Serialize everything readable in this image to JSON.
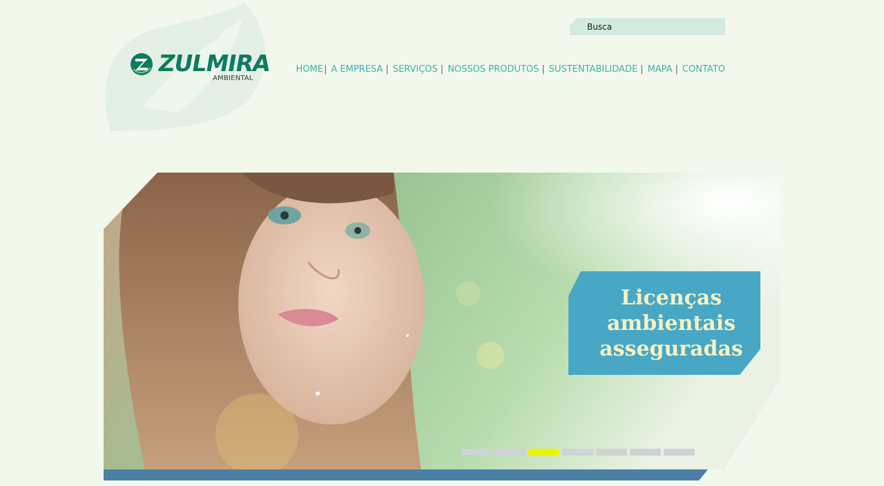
{
  "brand": {
    "name": "ZULMIRA",
    "subtitle": "AMBIENTAL",
    "colors": {
      "primary": "#0f7a5e",
      "nav": "#3ab1aa",
      "accent_bar": "#4a7fa6",
      "caption_bg": "#48a7c4",
      "caption_text": "#f4f2c4",
      "active_dot": "#ecf500"
    }
  },
  "search": {
    "placeholder": "Busca"
  },
  "nav": {
    "items": [
      {
        "label": "HOME"
      },
      {
        "label": "A EMPRESA"
      },
      {
        "label": "SERVIÇOS"
      },
      {
        "label": "NOSSOS PRODUTOS"
      },
      {
        "label": "SUSTENTABILIDADE"
      },
      {
        "label": "MAPA"
      },
      {
        "label": "CONTATO"
      }
    ],
    "separator": "|"
  },
  "banner": {
    "caption_lines": [
      "Licenças",
      "ambientais",
      "asseguradas"
    ],
    "slide_count": 7,
    "active_slide": 3
  }
}
